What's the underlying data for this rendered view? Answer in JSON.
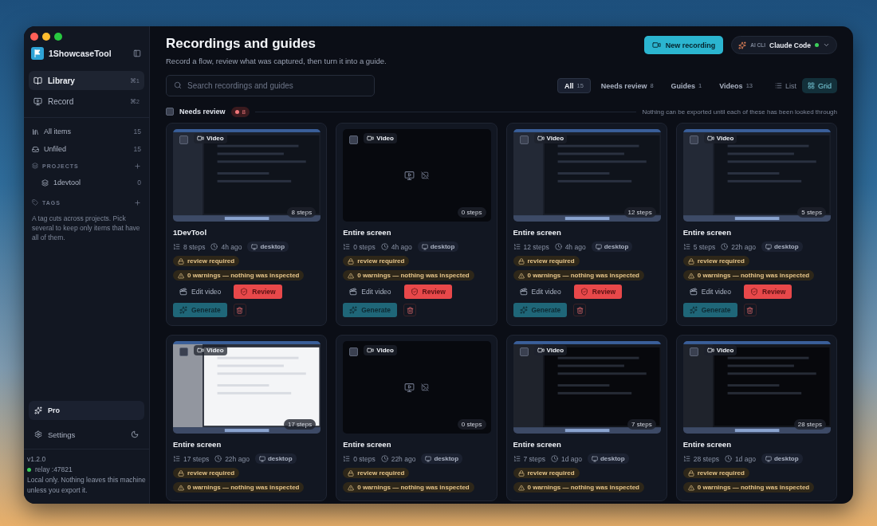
{
  "sidebar": {
    "app_name": "1ShowcaseTool",
    "nav": [
      {
        "label": "Library",
        "shortcut": "⌘1",
        "selected": true
      },
      {
        "label": "Record",
        "shortcut": "⌘2",
        "selected": false
      }
    ],
    "filters": [
      {
        "label": "All items",
        "count": "15"
      },
      {
        "label": "Unfiled",
        "count": "15"
      }
    ],
    "projects": {
      "heading": "PROJECTS",
      "items": [
        {
          "label": "1devtool",
          "count": "0"
        }
      ]
    },
    "tags": {
      "heading": "TAGS",
      "hint": "A tag cuts across projects. Pick several to keep only items that have all of them."
    },
    "pro": "Pro",
    "settings": "Settings",
    "footer": {
      "version": "v1.2.0",
      "relay": "relay :47821",
      "note": "Local only. Nothing leaves this machine unless you export it."
    }
  },
  "header": {
    "title": "Recordings and guides",
    "subtitle": "Record a flow, review what was captured, then turn it into a guide.",
    "new_recording": "New recording",
    "ai_cli": {
      "label": "AI CLI",
      "value": "Claude Code"
    }
  },
  "search": {
    "placeholder": "Search recordings and guides"
  },
  "tabs": [
    {
      "label": "All",
      "count": "15",
      "selected": true
    },
    {
      "label": "Needs review",
      "count": "8",
      "selected": false
    },
    {
      "label": "Guides",
      "count": "1",
      "selected": false
    },
    {
      "label": "Videos",
      "count": "13",
      "selected": false
    }
  ],
  "views": [
    {
      "label": "List",
      "selected": false
    },
    {
      "label": "Grid",
      "selected": true
    }
  ],
  "section": {
    "label": "Needs review",
    "count": "8",
    "checked": false,
    "note": "Nothing can be exported until each of these has been looked through"
  },
  "cards": [
    {
      "title": "1DevTool",
      "kind": "screen_dark",
      "checked": false,
      "media": "Video",
      "steps_badge": "8 steps",
      "steps": "8 steps",
      "time": "4h ago",
      "source": "desktop",
      "status": "review required",
      "warning": "0 warnings — nothing was inspected",
      "actions": {
        "edit": "Edit video",
        "review": "Review",
        "generate": "Generate"
      }
    },
    {
      "title": "Entire screen",
      "kind": "empty",
      "checked": false,
      "media": "Video",
      "steps_badge": "0 steps",
      "steps": "0 steps",
      "time": "4h ago",
      "source": "desktop",
      "status": "review required",
      "warning": "0 warnings — nothing was inspected",
      "actions": {
        "edit": "Edit video",
        "review": "Review",
        "generate": "Generate"
      }
    },
    {
      "title": "Entire screen",
      "kind": "screen_dark",
      "checked": false,
      "media": "Video",
      "steps_badge": "12 steps",
      "steps": "12 steps",
      "time": "4h ago",
      "source": "desktop",
      "status": "review required",
      "warning": "0 warnings — nothing was inspected",
      "actions": {
        "edit": "Edit video",
        "review": "Review",
        "generate": "Generate"
      }
    },
    {
      "title": "Entire screen",
      "kind": "screen_dark",
      "checked": false,
      "media": "Video",
      "steps_badge": "5 steps",
      "steps": "5 steps",
      "time": "22h ago",
      "source": "desktop",
      "status": "review required",
      "warning": "0 warnings — nothing was inspected",
      "actions": {
        "edit": "Edit video",
        "review": "Review",
        "generate": "Generate"
      }
    },
    {
      "title": "Entire screen",
      "kind": "screen_light",
      "checked": false,
      "media": "Video",
      "steps_badge": "17 steps",
      "steps": "17 steps",
      "time": "22h ago",
      "source": "desktop",
      "status": "review required",
      "warning": "0 warnings — nothing was inspected"
    },
    {
      "title": "Entire screen",
      "kind": "empty",
      "checked": false,
      "media": "Video",
      "steps_badge": "0 steps",
      "steps": "0 steps",
      "time": "22h ago",
      "source": "desktop",
      "status": "review required",
      "warning": "0 warnings — nothing was inspected"
    },
    {
      "title": "Entire screen",
      "kind": "screen_black",
      "checked": false,
      "media": "Video",
      "steps_badge": "7 steps",
      "steps": "7 steps",
      "time": "1d ago",
      "source": "desktop",
      "status": "review required",
      "warning": "0 warnings — nothing was inspected"
    },
    {
      "title": "Entire screen",
      "kind": "screen_black",
      "checked": false,
      "media": "Video",
      "steps_badge": "28 steps",
      "steps": "28 steps",
      "time": "1d ago",
      "source": "desktop",
      "status": "review required",
      "warning": "0 warnings — nothing was inspected"
    }
  ]
}
